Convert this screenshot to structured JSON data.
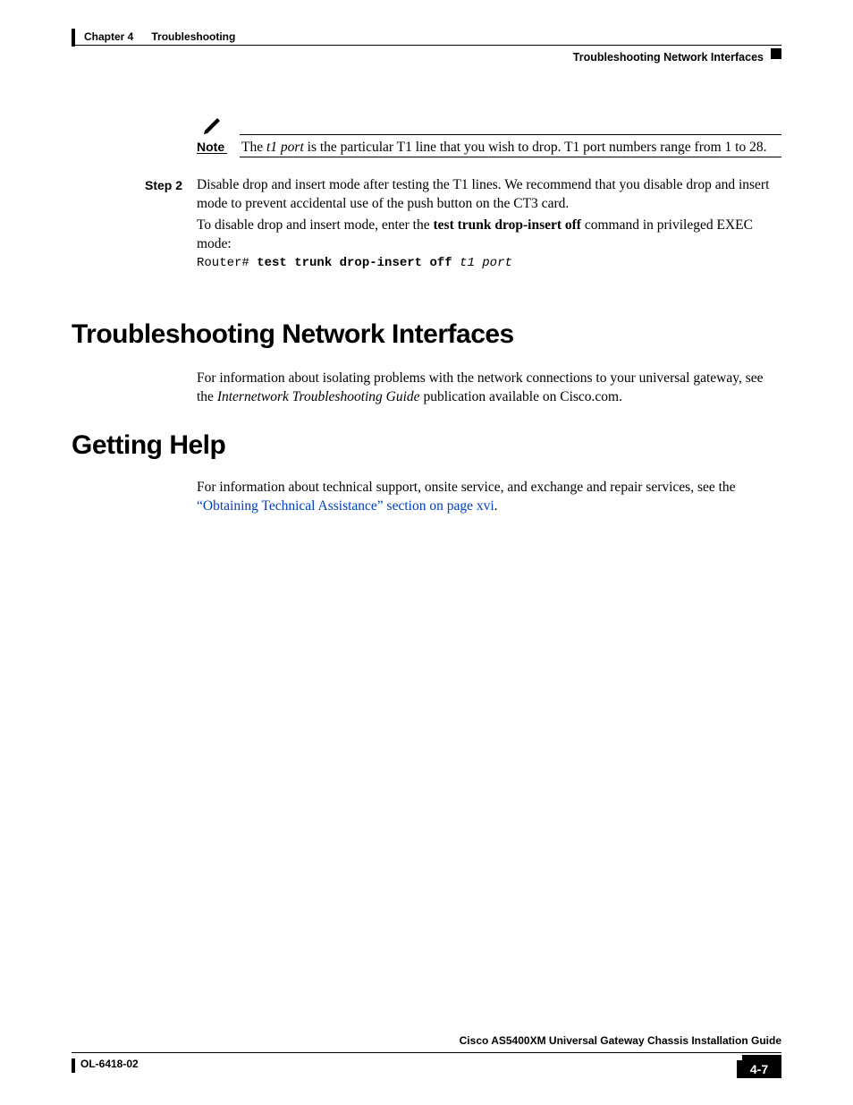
{
  "header": {
    "chapter_label": "Chapter 4      Troubleshooting",
    "section_label": "Troubleshooting Network Interfaces"
  },
  "note": {
    "label": "Note",
    "pre": "The ",
    "t1port": "t1 port",
    "post": " is the particular T1 line that you wish to drop. T1 port numbers range from 1 to 28."
  },
  "step": {
    "label": "Step 2",
    "p1": "Disable drop and insert mode after testing the T1 lines. We recommend that you disable drop and insert mode to prevent accidental use of the push button on the CT3 card.",
    "p2_pre": "To disable drop and insert mode, enter the ",
    "p2_cmd": "test trunk drop-insert off",
    "p2_post": " command in privileged EXEC mode:",
    "code_prompt": "Router# ",
    "code_cmd": "test trunk drop-insert off",
    "code_arg": " t1 port"
  },
  "sections": {
    "tni_heading": "Troubleshooting Network Interfaces",
    "tni_p_pre": "For information about isolating problems with the network connections to your universal gateway, see the ",
    "tni_p_em": "Internetwork Troubleshooting Guide",
    "tni_p_post": " publication available on Cisco.com.",
    "gh_heading": "Getting Help",
    "gh_p_pre": "For information about technical support, onsite service, and exchange and repair services, see the ",
    "gh_p_link": "“Obtaining Technical Assistance” section on page xvi",
    "gh_p_post": "."
  },
  "footer": {
    "guide": "Cisco AS5400XM Universal Gateway Chassis Installation Guide",
    "docnum": "OL-6418-02",
    "pagenum": "4-7"
  }
}
